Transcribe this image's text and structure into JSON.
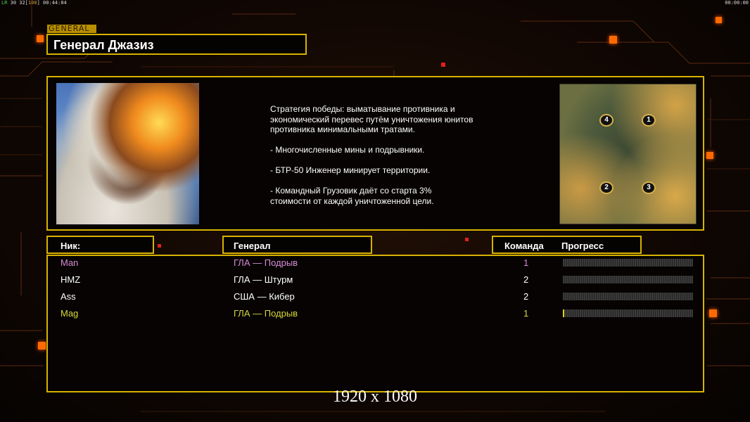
{
  "hud": {
    "top_left_fps": "30 32",
    "top_left_bracket": "100",
    "top_left_time": "00:44:04",
    "top_right_time": "00:00:00",
    "top_left_prefix": "LR"
  },
  "general_tag": "GENERAL",
  "title": "Генерал Джазиз",
  "description": "Стратегия победы: выматывание противника и\n экономический перевес путём уничтожения юнитов\n противника минимальными тратами.\n\n- Многочисленные мины и подрывники.\n\n- БТР-50 Инженер минирует территории.\n\n- Командный Грузовик даёт со старта 3%\n стоимости от каждой уничтоженной цели.",
  "map": {
    "slot_labels": [
      "4",
      "1",
      "2",
      "3"
    ]
  },
  "headers": {
    "nick": "Ник:",
    "general": "Генерал",
    "team": "Команда",
    "progress": "Прогресс"
  },
  "players": [
    {
      "nick": "Man",
      "general": "ГЛА — Подрыв",
      "team": "1",
      "progress": 0.0,
      "color": "#d68ad6"
    },
    {
      "nick": "HMZ",
      "general": "ГЛА — Штурм",
      "team": "2",
      "progress": 0.0,
      "color": "#ffffff"
    },
    {
      "nick": "Ass",
      "general": "США — Кибер",
      "team": "2",
      "progress": 0.0,
      "color": "#ffffff"
    },
    {
      "nick": "Mag",
      "general": "ГЛА — Подрыв",
      "team": "1",
      "progress": 0.01,
      "color": "#d8d83a"
    }
  ],
  "resolution_label": "1920 x 1080",
  "colors": {
    "frame": "#d7b200",
    "accent_orange": "#ff6a00",
    "accent_red": "#e0201a"
  }
}
